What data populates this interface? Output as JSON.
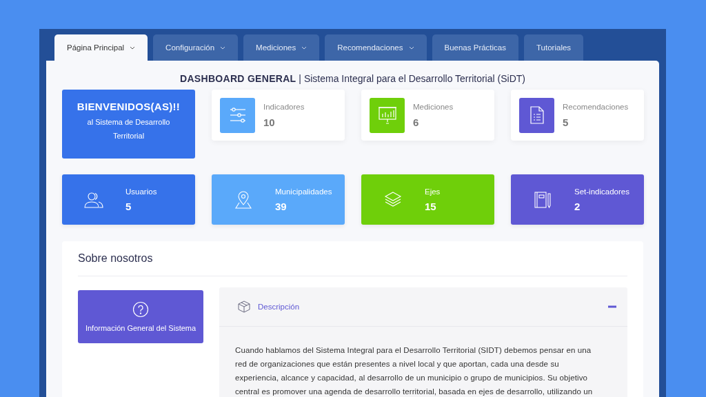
{
  "tabs": [
    {
      "label": "Página Principal",
      "selected": true,
      "dropdown": true
    },
    {
      "label": "Configuración",
      "selected": false,
      "dropdown": true
    },
    {
      "label": "Mediciones",
      "selected": false,
      "dropdown": true
    },
    {
      "label": "Recomendaciones",
      "selected": false,
      "dropdown": true
    },
    {
      "label": "Buenas Prácticas",
      "selected": false,
      "dropdown": false
    },
    {
      "label": "Tutoriales",
      "selected": false,
      "dropdown": false
    }
  ],
  "heading": {
    "bold": "DASHBOARD GENERAL",
    "separator": "|",
    "rest": "Sistema Integral para el Desarrollo Territorial (SiDT)"
  },
  "welcome": {
    "title": "BIENVENIDOS(AS)!!",
    "subtitle": "al Sistema de Desarrollo Territorial"
  },
  "summary_cards": [
    {
      "label": "Indicadores",
      "value": "10",
      "color": "#5aa9fa"
    },
    {
      "label": "Mediciones",
      "value": "6",
      "color": "#6fcf0a"
    },
    {
      "label": "Recomendaciones",
      "value": "5",
      "color": "#5f58d4"
    }
  ],
  "stat_cards": [
    {
      "label": "Usuarios",
      "value": "5",
      "color": "#3672ea"
    },
    {
      "label": "Municipalidades",
      "value": "39",
      "color": "#5aa9fa"
    },
    {
      "label": "Ejes",
      "value": "15",
      "color": "#6fcf0a"
    },
    {
      "label": "Set-indicadores",
      "value": "2",
      "color": "#5f58d4"
    }
  ],
  "about": {
    "title": "Sobre nosotros",
    "menu_button": "Información General del Sistema",
    "accordion": {
      "title": "Descripción",
      "expanded": true,
      "text": "Cuando hablamos del Sistema Integral para el Desarrollo Territorial (SIDT) debemos pensar en una red de organizaciones que están presentes a nivel local y que aportan, cada una desde su experiencia, alcance y capacidad, al desarrollo de un municipio o grupo de municipios. Su objetivo central es promover una agenda de desarrollo territorial, basada en ejes de desarrollo, utilizando un"
    }
  }
}
